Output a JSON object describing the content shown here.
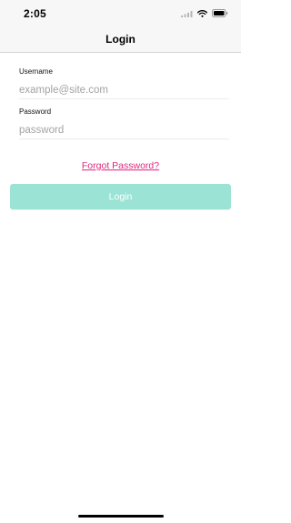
{
  "status_bar": {
    "time": "2:05",
    "icons": [
      "signal-icon",
      "wifi-icon",
      "battery-icon"
    ]
  },
  "nav": {
    "title": "Login"
  },
  "form": {
    "username": {
      "label": "Username",
      "value": "",
      "placeholder": "example@site.com"
    },
    "password": {
      "label": "Password",
      "value": "",
      "placeholder": "password"
    },
    "forgot_password_label": "Forgot Password?",
    "login_button_label": "Login"
  },
  "colors": {
    "accent_link": "#e0267f",
    "login_button_bg": "#9be3d5",
    "bar_bg": "#f7f7f7"
  }
}
